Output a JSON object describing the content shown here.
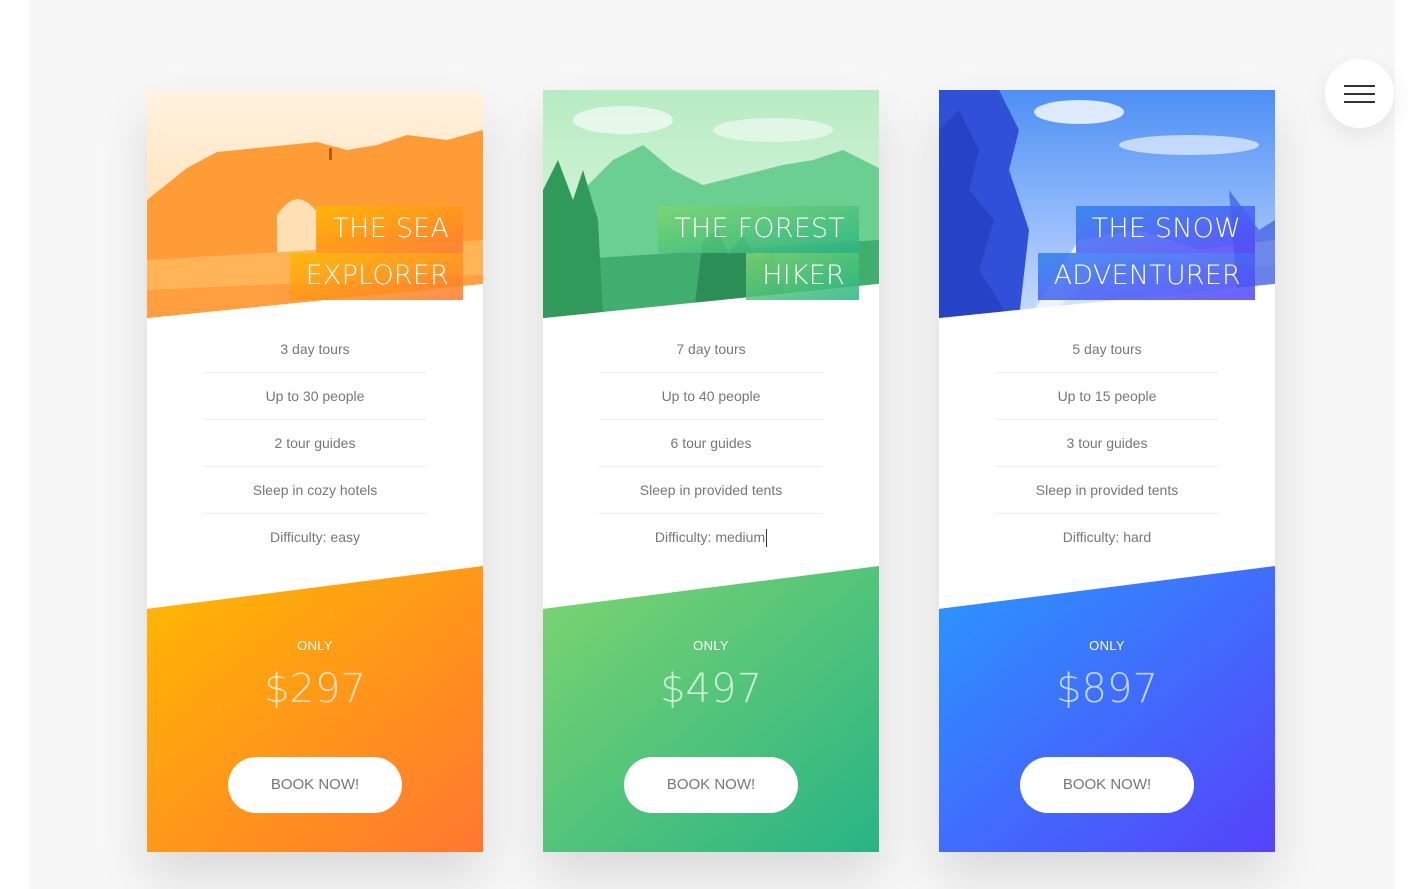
{
  "menu": {
    "icon": "hamburger-menu-icon"
  },
  "colors": {
    "page_background": "#f7f7f7",
    "orange_start": "#ffb900",
    "orange_end": "#ff7730",
    "green_start": "#7ed56f",
    "green_end": "#28b485",
    "blue_start": "#2998ff",
    "blue_end": "#5643fa"
  },
  "cards": [
    {
      "heading_line1": "THE SEA",
      "heading_line2": "EXPLORER",
      "details": [
        "3 day tours",
        "Up to 30 people",
        "2 tour guides",
        "Sleep in cozy hotels",
        "Difficulty: easy"
      ],
      "price_label": "ONLY",
      "price": "$297",
      "button": "BOOK NOW!"
    },
    {
      "heading_line1": "THE FOREST",
      "heading_line2": "HIKER",
      "details": [
        "7 day tours",
        "Up to 40 people",
        "6 tour guides",
        "Sleep in provided tents",
        "Difficulty: medium"
      ],
      "price_label": "ONLY",
      "price": "$497",
      "button": "BOOK NOW!"
    },
    {
      "heading_line1": "THE SNOW",
      "heading_line2": "ADVENTURER",
      "details": [
        "5 day tours",
        "Up to 15 people",
        "3 tour guides",
        "Sleep in provided tents",
        "Difficulty: hard"
      ],
      "price_label": "ONLY",
      "price": "$897",
      "button": "BOOK NOW!"
    }
  ]
}
